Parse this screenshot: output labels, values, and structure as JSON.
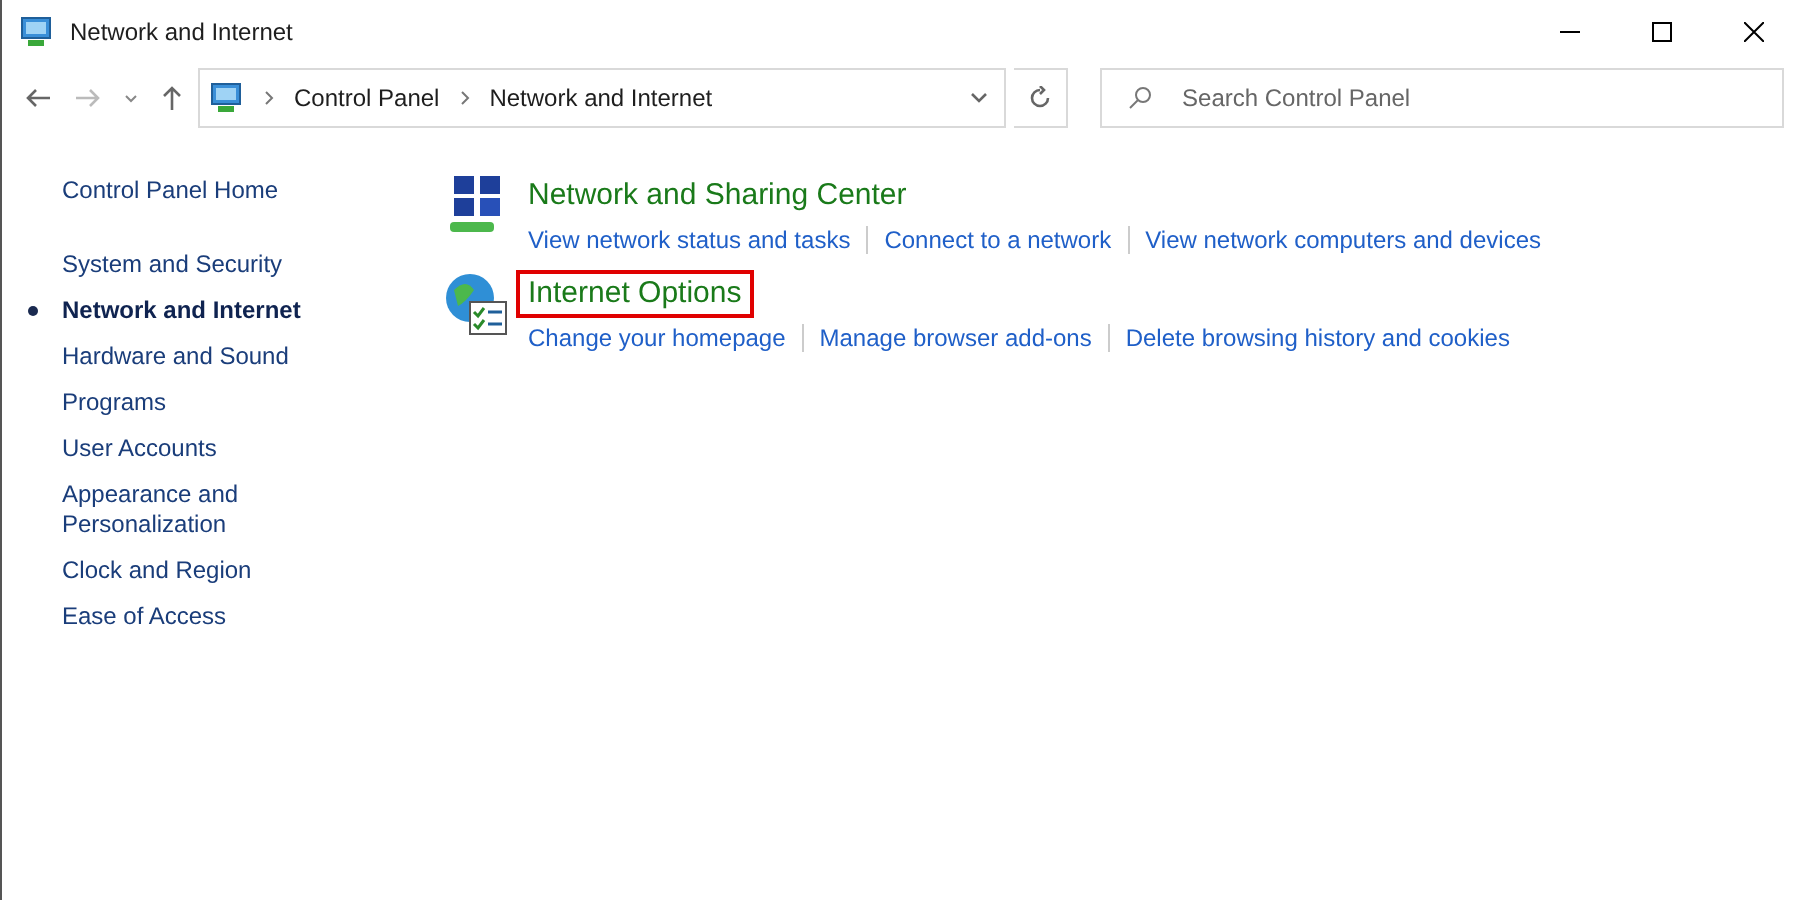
{
  "window": {
    "title": "Network and Internet"
  },
  "address_bar": {
    "crumbs": [
      "Control Panel",
      "Network and Internet"
    ]
  },
  "search": {
    "placeholder": "Search Control Panel"
  },
  "sidebar": {
    "home": "Control Panel Home",
    "items": [
      {
        "label": "System and Security",
        "selected": false
      },
      {
        "label": "Network and Internet",
        "selected": true
      },
      {
        "label": "Hardware and Sound",
        "selected": false
      },
      {
        "label": "Programs",
        "selected": false
      },
      {
        "label": "User Accounts",
        "selected": false
      },
      {
        "label": "Appearance and Personalization",
        "selected": false
      },
      {
        "label": "Clock and Region",
        "selected": false
      },
      {
        "label": "Ease of Access",
        "selected": false
      }
    ]
  },
  "categories": [
    {
      "kind": "network",
      "title": "Network and Sharing Center",
      "highlighted": false,
      "links": [
        "View network status and tasks",
        "Connect to a network",
        "View network computers and devices"
      ]
    },
    {
      "kind": "internet",
      "title": "Internet Options",
      "highlighted": true,
      "links": [
        "Change your homepage",
        "Manage browser add-ons",
        "Delete browsing history and cookies"
      ]
    }
  ]
}
